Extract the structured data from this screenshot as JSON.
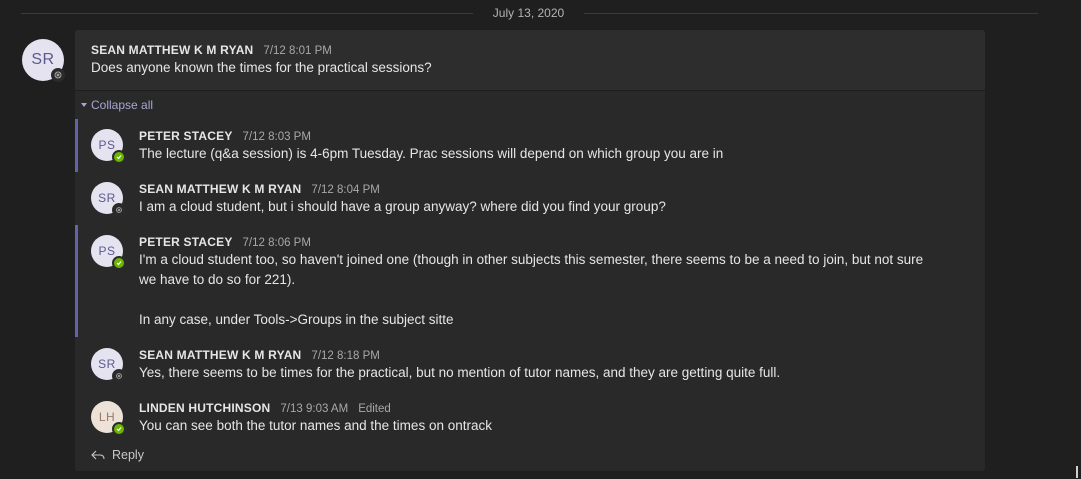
{
  "date_divider": "July 13, 2020",
  "root_message": {
    "initials": "SR",
    "author": "SEAN MATTHEW K M RYAN",
    "time": "7/12 8:01 PM",
    "body": "Does anyone known the times for the practical sessions?"
  },
  "collapse_label": "Collapse all",
  "replies": [
    {
      "initials": "PS",
      "author": "PETER STACEY",
      "time": "7/12 8:03 PM",
      "body_lines": [
        "The lecture (q&a session) is 4-6pm Tuesday. Prac sessions will depend on which group you are in"
      ],
      "presence": "available"
    },
    {
      "initials": "SR",
      "author": "SEAN MATTHEW K M RYAN",
      "time": "7/12 8:04 PM",
      "body_lines": [
        "I am a cloud student, but i should have a group anyway? where did you find your group?"
      ],
      "presence": "offline"
    },
    {
      "initials": "PS",
      "author": "PETER STACEY",
      "time": "7/12 8:06 PM",
      "body_lines": [
        "I'm a cloud student too, so haven't joined one (though in other subjects this semester, there seems to be a need to join, but not sure",
        "we have to do so for 221).",
        "In any case, under Tools->Groups in the subject sitte"
      ],
      "presence": "available"
    },
    {
      "initials": "SR",
      "author": "SEAN MATTHEW K M RYAN",
      "time": "7/12 8:18 PM",
      "body_lines": [
        "Yes, there seems to be times for the practical, but no mention of tutor names, and they are getting quite full."
      ],
      "presence": "offline"
    },
    {
      "initials": "LH",
      "author": "LINDEN HUTCHINSON",
      "time": "7/13 9:03 AM",
      "edited": "Edited",
      "body_lines": [
        "You can see both the tutor names and the times on ontrack"
      ],
      "presence": "available"
    }
  ],
  "reply_label": "Reply",
  "colors": {
    "accent": "#6264a7",
    "available": "#6bb700",
    "background": "#1f1f1f",
    "card": "#292929"
  }
}
